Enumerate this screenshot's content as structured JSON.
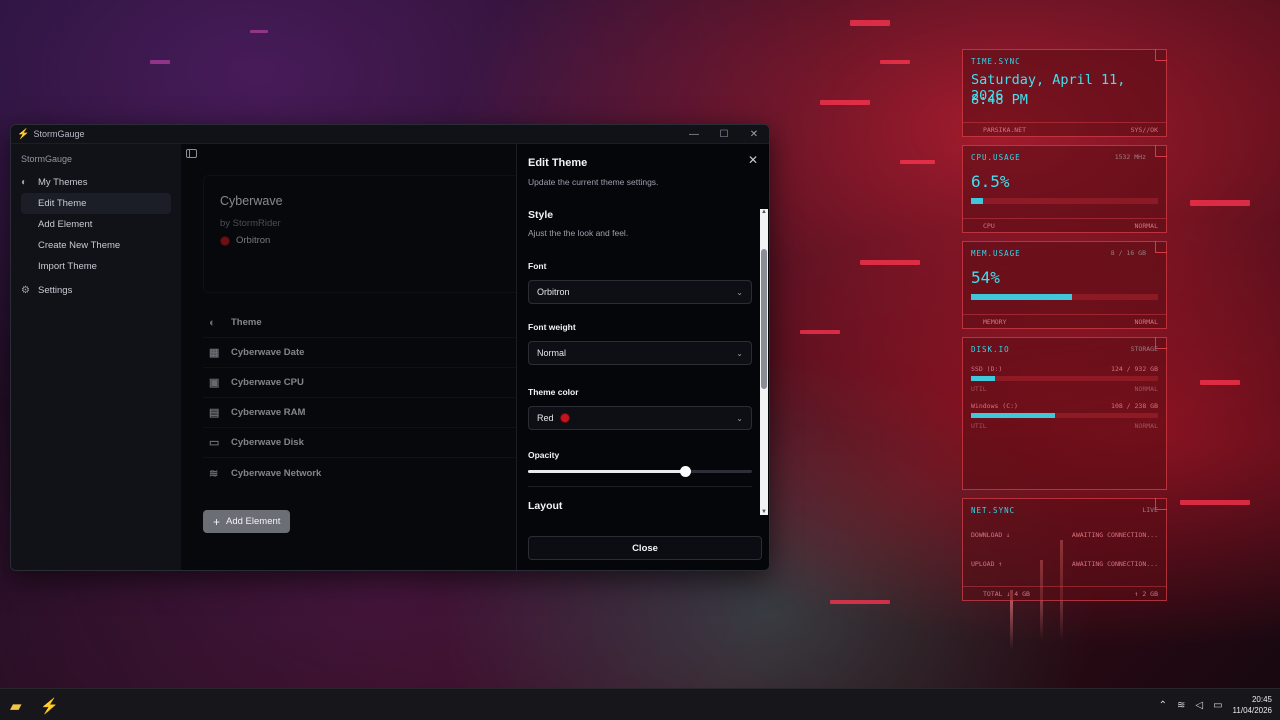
{
  "window": {
    "title": "StormGauge",
    "minimize_icon": "minimize-icon",
    "maximize_icon": "maximize-icon",
    "close_icon": "close-icon"
  },
  "sidebar": {
    "app_label": "StormGauge",
    "my_themes": "My Themes",
    "items": [
      "Edit Theme",
      "Add Element",
      "Create New Theme",
      "Import Theme"
    ],
    "settings": "Settings"
  },
  "theme": {
    "name": "Cyberwave",
    "author": "by StormRider",
    "font": "Orbitron",
    "color": "#c4141e"
  },
  "elements": [
    {
      "label": "Theme",
      "icon": "palette-icon"
    },
    {
      "label": "Cyberwave Date",
      "icon": "calendar-icon"
    },
    {
      "label": "Cyberwave CPU",
      "icon": "cpu-icon"
    },
    {
      "label": "Cyberwave RAM",
      "icon": "memory-icon"
    },
    {
      "label": "Cyberwave Disk",
      "icon": "disk-icon"
    },
    {
      "label": "Cyberwave Network",
      "icon": "wifi-icon"
    }
  ],
  "add_element": "Add Element",
  "panel": {
    "title": "Edit Theme",
    "subtitle": "Update the current theme settings.",
    "style_title": "Style",
    "style_sub": "Ajust the the look and feel.",
    "font_label": "Font",
    "font_value": "Orbitron",
    "weight_label": "Font weight",
    "weight_value": "Normal",
    "color_label": "Theme color",
    "color_value": "Red",
    "opacity_label": "Opacity",
    "opacity_value": 0.7,
    "layout_title": "Layout",
    "close_label": "Close"
  },
  "widgets": {
    "time": {
      "label": "TIME.SYNC",
      "date": "Saturday, April 11, 2026",
      "time": "8:48 PM",
      "foot_l": "PARSIKA.NET",
      "foot_r": "SYS//OK"
    },
    "cpu": {
      "label": "CPU.USAGE",
      "freq": "1532 MHz",
      "value": "6.5%",
      "fraction": 0.065,
      "foot_l": "CPU",
      "foot_r": "NORMAL"
    },
    "mem": {
      "label": "MEM.USAGE",
      "amount": "8 / 16 GB",
      "value": "54%",
      "fraction": 0.54,
      "foot_l": "MEMORY",
      "foot_r": "NORMAL"
    },
    "disk": {
      "label": "DISK.IO",
      "tag": "STORAGE",
      "d1_name": "SSD (D:)",
      "d1_amount": "124 / 932 GB",
      "d1_fraction": 0.13,
      "d1_util": "UTIL",
      "d1_status": "NORMAL",
      "d2_name": "Windows (C:)",
      "d2_amount": "108 / 238 GB",
      "d2_fraction": 0.45,
      "d2_util": "UTIL",
      "d2_status": "NORMAL"
    },
    "net": {
      "label": "NET.SYNC",
      "tag": "LIVE",
      "down": "DOWNLOAD ↓",
      "down_val": "AWAITING CONNECTION...",
      "up": "UPLOAD ↑",
      "up_val": "AWAITING CONNECTION...",
      "total": "TOTAL ↓ 4 GB",
      "total_r": "↑ 2 GB"
    }
  },
  "taskbar": {
    "time": "20:45",
    "date": "11/04/2026"
  },
  "colors": {
    "accent": "#41e0f0",
    "widget_border": "#ff5060",
    "theme_red": "#c4141e"
  }
}
